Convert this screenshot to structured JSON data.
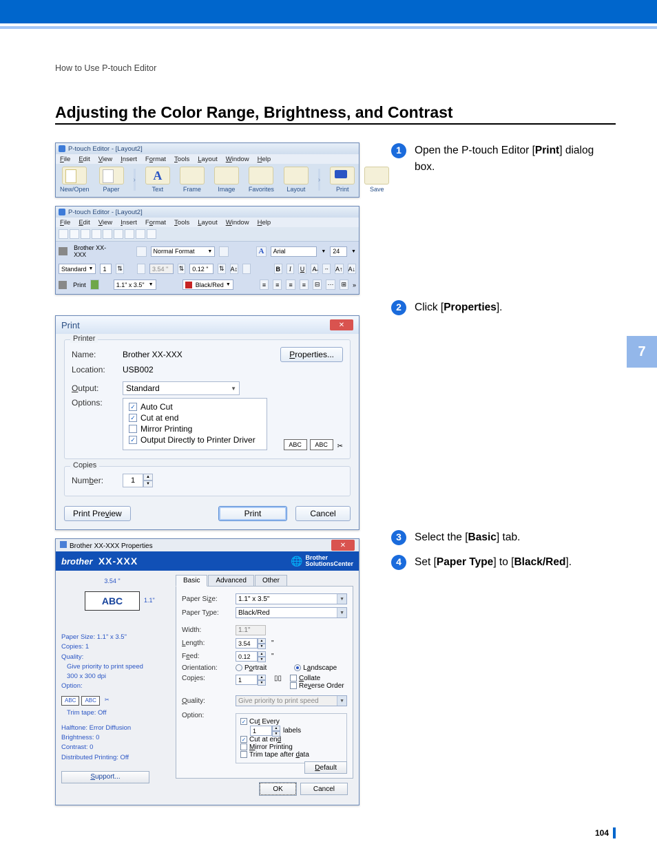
{
  "chapter_tab": "7",
  "page_number": "104",
  "crumb": "How to Use P-touch Editor",
  "heading": "Adjusting the Color Range, Brightness, and Contrast",
  "steps": [
    {
      "n": "1",
      "pre": "Open the P-touch Editor [",
      "bold": "Print",
      "post": "] dialog box."
    },
    {
      "n": "2",
      "pre": "Click [",
      "bold": "Properties",
      "post": "]."
    },
    {
      "n": "3",
      "pre": "Select the [",
      "bold": "Basic",
      "post": "] tab."
    },
    {
      "n": "4",
      "pre": "Set [",
      "bold": "Paper Type",
      "post": "] to [",
      "bold2": "Black/Red",
      "post2": "]."
    }
  ],
  "shot1": {
    "title": "P-touch Editor - [Layout2]",
    "menu": [
      "File",
      "Edit",
      "View",
      "Insert",
      "Format",
      "Tools",
      "Layout",
      "Window",
      "Help"
    ],
    "items": [
      "New/Open",
      "Paper",
      "Text",
      "Frame",
      "Image",
      "Favorites",
      "Layout",
      "Print",
      "Save"
    ]
  },
  "shot2": {
    "title": "P-touch Editor - [Layout2]",
    "menu": [
      "File",
      "Edit",
      "View",
      "Insert",
      "Format",
      "Tools",
      "Layout",
      "Window",
      "Help"
    ],
    "printer": "Brother XX-XXX",
    "mode": "Standard",
    "copies": "1",
    "print_lbl": "Print",
    "format": "Normal Format",
    "len": "3.54 \"",
    "gap": "0.12 \"",
    "size_combo": "1.1\" x 3.5\"",
    "color": "Black/Red",
    "font": "Arial",
    "fontsize": "24"
  },
  "dlg3": {
    "title": "Print",
    "group_printer": "Printer",
    "name_lbl": "Name:",
    "name": "Brother  XX-XXX",
    "loc_lbl": "Location:",
    "loc": "USB002",
    "out_lbl": "Output:",
    "out": "Standard",
    "opt_lbl": "Options:",
    "opts": [
      {
        "label": "Auto Cut",
        "checked": true
      },
      {
        "label": "Cut at end",
        "checked": true
      },
      {
        "label": "Mirror Printing",
        "checked": false
      },
      {
        "label": "Output Directly to Printer Driver",
        "checked": true
      }
    ],
    "properties_btn": "Properties...",
    "abc": "ABC",
    "group_copies": "Copies",
    "num_lbl": "Number:",
    "num": "1",
    "preview_btn": "Print Preview",
    "print_btn": "Print",
    "cancel_btn": "Cancel"
  },
  "dlg4": {
    "title": "Brother   XX-XXX Properties",
    "brand": "brother",
    "model": "XX-XXX",
    "sc": "Brother\nSolutionsCenter",
    "preview_text": "ABC",
    "dim_w": "3.54 \"",
    "dim_h": "1.1\"",
    "left_info": {
      "paper": "Paper Size: 1.1\" x 3.5\"",
      "copies": "Copies: 1",
      "quality": "Quality:",
      "q1": "Give priority to print speed",
      "q2": "300 x 300 dpi",
      "option": "Option:",
      "trim": "Trim tape: Off",
      "half": "Halftone: Error Diffusion",
      "bright": "Brightness:  0",
      "contrast": "Contrast:  0",
      "dist": "Distributed Printing: Off",
      "support": "Support..."
    },
    "tabs": [
      "Basic",
      "Advanced",
      "Other"
    ],
    "fields": {
      "psize_lbl": "Paper Size:",
      "psize": "1.1\" x 3.5\"",
      "ptype_lbl": "Paper Type:",
      "ptype": "Black/Red",
      "width_lbl": "Width:",
      "width": "1.1\"",
      "length_lbl": "Length:",
      "length": "3.54",
      "unit": "\"",
      "feed_lbl": "Feed:",
      "feed": "0.12",
      "orient_lbl": "Orientation:",
      "portrait": "Portrait",
      "landscape": "Landscape",
      "copies_lbl": "Copies:",
      "copies": "1",
      "collate": "Collate",
      "reverse": "Reverse Order",
      "quality_lbl": "Quality:",
      "quality": "Give priority to print speed",
      "option_lbl": "Option:",
      "cut_every": "Cut Every",
      "cut_labels": "labels",
      "cut_num": "1",
      "cut_end": "Cut at end",
      "mirror": "Mirror Printing",
      "trim_after": "Trim tape after data",
      "default": "Default",
      "ok": "OK",
      "cancel": "Cancel"
    }
  }
}
